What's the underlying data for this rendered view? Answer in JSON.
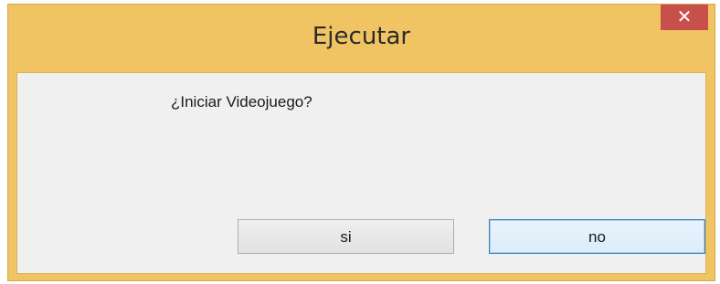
{
  "window": {
    "title": "Ejecutar",
    "close_glyph": "✕",
    "frame_color": "#f0c463",
    "close_color": "#c7504b"
  },
  "dialog": {
    "message": "¿Iniciar Videojuego?"
  },
  "buttons": {
    "yes_label": "si",
    "no_label": "no"
  },
  "icons": {
    "close": "close-icon"
  }
}
